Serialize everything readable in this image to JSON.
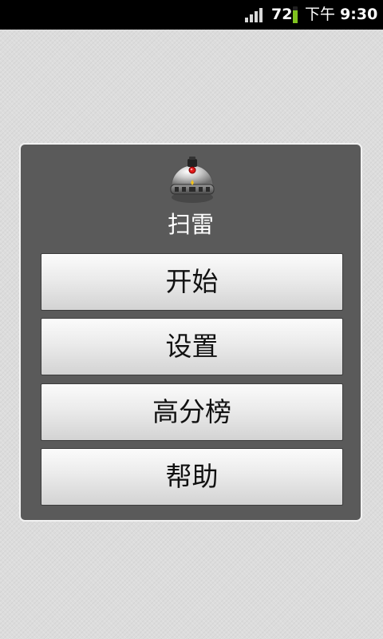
{
  "status_bar": {
    "battery_level": "72",
    "am_pm": "下午",
    "time": "9:30",
    "signal_icon": "signal-bars-icon",
    "battery_icon": "battery-icon",
    "battery_color": "#7fc21f"
  },
  "dialog": {
    "icon": "minesweeper-bomb-icon",
    "title": "扫雷",
    "buttons": [
      {
        "label": "开始"
      },
      {
        "label": "设置"
      },
      {
        "label": "高分榜"
      },
      {
        "label": "帮助"
      }
    ]
  }
}
